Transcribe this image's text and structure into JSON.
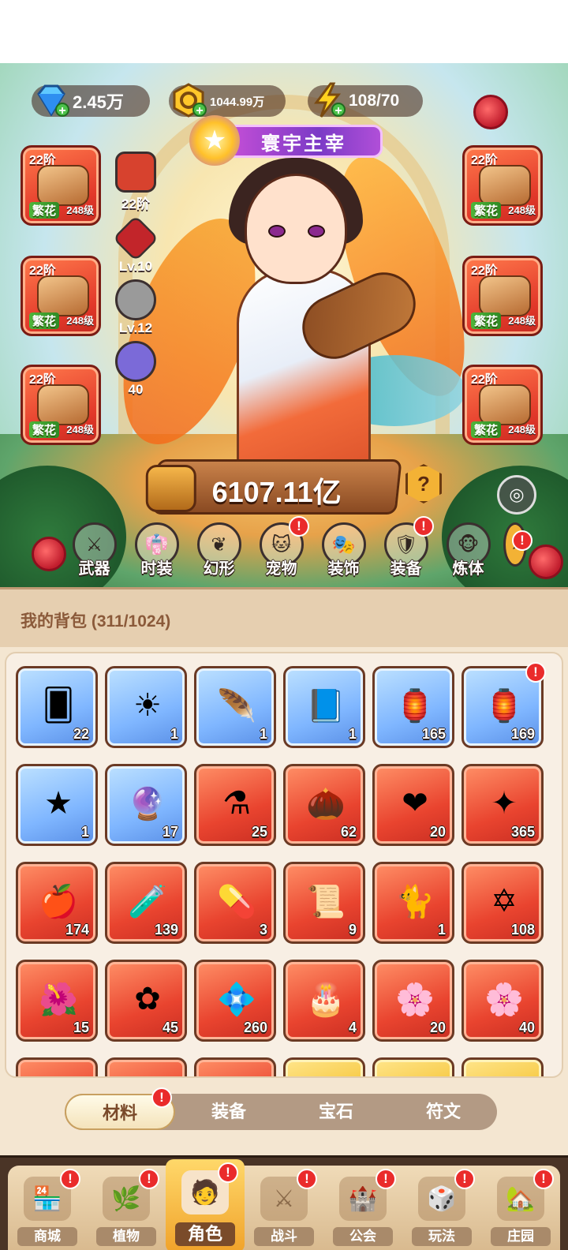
{
  "resources": [
    {
      "name": "diamond",
      "value": "2.45万",
      "icon": "diamond-icon"
    },
    {
      "name": "gold",
      "value": "1044.99万",
      "icon": "gold-coin-icon"
    },
    {
      "name": "energy",
      "value": "108/70",
      "icon": "lightning-icon"
    }
  ],
  "title": "寰宇主宰",
  "equipment": {
    "left": [
      {
        "tier": "22阶",
        "tag": "繁花",
        "level": "248级"
      },
      {
        "tier": "22阶",
        "tag": "繁花",
        "level": "248级"
      },
      {
        "tier": "22阶",
        "tag": "繁花",
        "level": "248级"
      }
    ],
    "right": [
      {
        "tier": "22阶",
        "tag": "繁花",
        "level": "248级"
      },
      {
        "tier": "22阶",
        "tag": "繁花",
        "level": "248级"
      },
      {
        "tier": "22阶",
        "tag": "繁花",
        "level": "248级"
      }
    ],
    "mini": [
      {
        "label": "22阶",
        "icon": "red-book-icon",
        "color": "#d7422e"
      },
      {
        "label": "Lv.10",
        "icon": "red-crystal-icon",
        "color": "#c2252a"
      },
      {
        "label": "Lv.12",
        "icon": "star-emblem-icon",
        "color": "#8a8a8a"
      },
      {
        "label": "40",
        "icon": "purple-orb-icon",
        "color": "#7b6ad8"
      }
    ]
  },
  "combat_power": "6107.11亿",
  "role_menu": [
    {
      "label": "武器",
      "icon": "weapon-icon",
      "badge": false
    },
    {
      "label": "时装",
      "icon": "costume-icon",
      "badge": false
    },
    {
      "label": "幻形",
      "icon": "transform-icon",
      "badge": false
    },
    {
      "label": "宠物",
      "icon": "pet-icon",
      "badge": true
    },
    {
      "label": "装饰",
      "icon": "mask-icon",
      "badge": false
    },
    {
      "label": "装备",
      "icon": "equipment-icon",
      "badge": true
    },
    {
      "label": "炼体",
      "icon": "body-icon",
      "badge": false
    }
  ],
  "bag": {
    "title": "我的背包",
    "capacity": "(311/1024)",
    "items": [
      {
        "qty": "22",
        "color": "blue",
        "icon": "card-icon",
        "glyph": "🂠"
      },
      {
        "qty": "1",
        "color": "blue",
        "icon": "sun-emblem-icon",
        "glyph": "☀"
      },
      {
        "qty": "1",
        "color": "blue",
        "icon": "feather-icon",
        "glyph": "🪶"
      },
      {
        "qty": "1",
        "color": "blue",
        "icon": "spellbook-icon",
        "glyph": "📘"
      },
      {
        "qty": "165",
        "color": "blue",
        "icon": "lantern-icon",
        "glyph": "🏮"
      },
      {
        "qty": "169",
        "color": "blue",
        "icon": "lantern-icon",
        "glyph": "🏮",
        "badge": true
      },
      {
        "qty": "1",
        "color": "blue",
        "icon": "star-icon",
        "glyph": "★"
      },
      {
        "qty": "17",
        "color": "blue",
        "icon": "orb-ring-icon",
        "glyph": "🔮"
      },
      {
        "qty": "25",
        "color": "red",
        "icon": "potion-bottle-icon",
        "glyph": "⚗"
      },
      {
        "qty": "62",
        "color": "red",
        "icon": "golden-seed-icon",
        "glyph": "🌰"
      },
      {
        "qty": "20",
        "color": "red",
        "icon": "flame-heart-icon",
        "glyph": "❤"
      },
      {
        "qty": "365",
        "color": "red",
        "icon": "crystal-star-icon",
        "glyph": "✦"
      },
      {
        "qty": "174",
        "color": "red",
        "icon": "red-potion-icon",
        "glyph": "🍎"
      },
      {
        "qty": "139",
        "color": "red",
        "icon": "green-tube-icon",
        "glyph": "🧪"
      },
      {
        "qty": "3",
        "color": "red",
        "icon": "green-gem-icon",
        "glyph": "💊"
      },
      {
        "qty": "9",
        "color": "red",
        "icon": "red-scroll-icon",
        "glyph": "📜"
      },
      {
        "qty": "1",
        "color": "red",
        "icon": "shadow-cat-icon",
        "glyph": "🐈"
      },
      {
        "qty": "108",
        "color": "red",
        "icon": "crystal-hexagram-icon",
        "glyph": "✡"
      },
      {
        "qty": "15",
        "color": "red",
        "icon": "red-flower-icon",
        "glyph": "🌺"
      },
      {
        "qty": "45",
        "color": "red",
        "icon": "petal-knot-icon",
        "glyph": "✿"
      },
      {
        "qty": "260",
        "color": "red",
        "icon": "purple-gems-icon",
        "glyph": "💠"
      },
      {
        "qty": "4",
        "color": "red",
        "icon": "cake-icon",
        "glyph": "🎂"
      },
      {
        "qty": "20",
        "color": "red",
        "icon": "lotus-duo-icon",
        "glyph": "🌸"
      },
      {
        "qty": "40",
        "color": "red",
        "icon": "lotus-duo-icon",
        "glyph": "🌸"
      },
      {
        "qty": "",
        "color": "red",
        "icon": "partial-item-icon",
        "glyph": ""
      },
      {
        "qty": "",
        "color": "red",
        "icon": "partial-item-icon",
        "glyph": ""
      },
      {
        "qty": "",
        "color": "red",
        "icon": "partial-item-icon",
        "glyph": ""
      },
      {
        "qty": "",
        "color": "gold",
        "icon": "partial-item-icon",
        "glyph": ""
      },
      {
        "qty": "",
        "color": "gold",
        "icon": "partial-item-icon",
        "glyph": ""
      },
      {
        "qty": "",
        "color": "gold",
        "icon": "partial-item-icon",
        "glyph": ""
      }
    ]
  },
  "tabs": [
    {
      "label": "材料",
      "active": true,
      "badge": true
    },
    {
      "label": "装备",
      "active": false,
      "badge": false
    },
    {
      "label": "宝石",
      "active": false,
      "badge": false
    },
    {
      "label": "符文",
      "active": false,
      "badge": false
    }
  ],
  "nav": [
    {
      "label": "商城",
      "icon": "shop-icon",
      "glyph": "🏪",
      "active": false
    },
    {
      "label": "植物",
      "icon": "plant-icon",
      "glyph": "🌿",
      "active": false
    },
    {
      "label": "角色",
      "icon": "character-icon",
      "glyph": "🧑",
      "active": true
    },
    {
      "label": "战斗",
      "icon": "battle-icon",
      "glyph": "⚔",
      "active": false
    },
    {
      "label": "公会",
      "icon": "guild-icon",
      "glyph": "🏰",
      "active": false
    },
    {
      "label": "玩法",
      "icon": "gameplay-icon",
      "glyph": "🎲",
      "active": false
    },
    {
      "label": "庄园",
      "icon": "manor-icon",
      "glyph": "🏡",
      "active": false
    }
  ],
  "badge_symbol": "!",
  "help_symbol": "?",
  "hide_symbol": "◎"
}
